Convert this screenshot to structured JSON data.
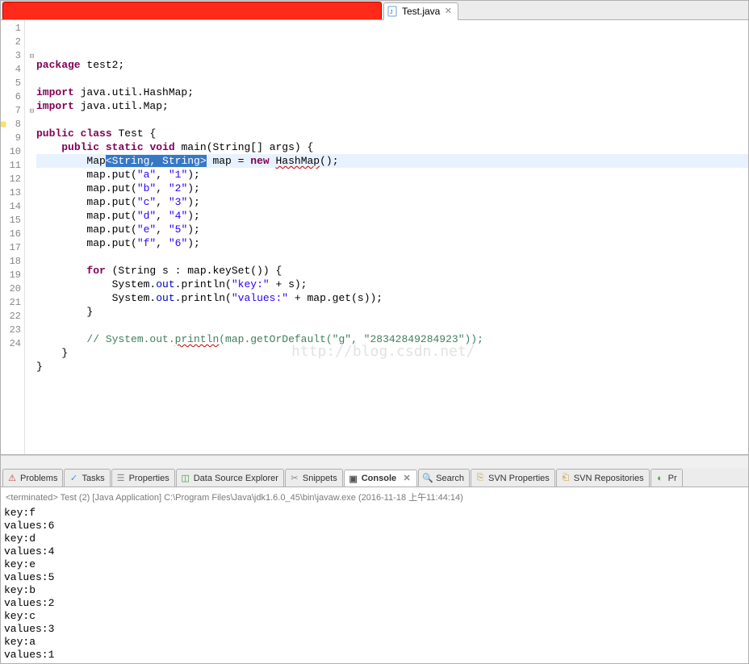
{
  "editor_tab": {
    "filename": "Test.java",
    "close_glyph": "✕"
  },
  "code": {
    "lines": [
      {
        "n": 1,
        "html": "<span class='kw'>package</span> test2;"
      },
      {
        "n": 2,
        "html": ""
      },
      {
        "n": 3,
        "fold": true,
        "html": "<span class='kw'>import</span> java.util.HashMap;"
      },
      {
        "n": 4,
        "html": "<span class='kw'>import</span> java.util.Map;"
      },
      {
        "n": 5,
        "html": ""
      },
      {
        "n": 6,
        "html": "<span class='kw'>public</span> <span class='kw'>class</span> Test {"
      },
      {
        "n": 7,
        "fold": true,
        "html": "    <span class='kw'>public</span> <span class='kw'>static</span> <span class='kw'>void</span> main(String[] args) {"
      },
      {
        "n": 8,
        "warn": true,
        "hl": true,
        "html": "        Map<span class='sel'>&lt;String, String&gt;</span> map = <span class='kw'>new</span> <span class='squig'>HashMap</span>();"
      },
      {
        "n": 9,
        "html": "        map.put(<span class='str'>\"a\"</span>, <span class='str'>\"1\"</span>);"
      },
      {
        "n": 10,
        "html": "        map.put(<span class='str'>\"b\"</span>, <span class='str'>\"2\"</span>);"
      },
      {
        "n": 11,
        "html": "        map.put(<span class='str'>\"c\"</span>, <span class='str'>\"3\"</span>);"
      },
      {
        "n": 12,
        "html": "        map.put(<span class='str'>\"d\"</span>, <span class='str'>\"4\"</span>);"
      },
      {
        "n": 13,
        "html": "        map.put(<span class='str'>\"e\"</span>, <span class='str'>\"5\"</span>);"
      },
      {
        "n": 14,
        "html": "        map.put(<span class='str'>\"f\"</span>, <span class='str'>\"6\"</span>);"
      },
      {
        "n": 15,
        "html": ""
      },
      {
        "n": 16,
        "html": "        <span class='kw'>for</span> (String s : map.keySet()) {"
      },
      {
        "n": 17,
        "html": "            System.<span class='fld'>out</span>.println(<span class='str'>\"key:\"</span> + s);"
      },
      {
        "n": 18,
        "html": "            System.<span class='fld'>out</span>.println(<span class='str'>\"values:\"</span> + map.get(s));"
      },
      {
        "n": 19,
        "html": "        }"
      },
      {
        "n": 20,
        "html": ""
      },
      {
        "n": 21,
        "html": "        <span class='cmt'>// System.out.<span class='squig'>println</span>(map.getOrDefault(\"g\", \"28342849284923\"));</span>"
      },
      {
        "n": 22,
        "html": "    }"
      },
      {
        "n": 23,
        "html": "}"
      },
      {
        "n": 24,
        "html": ""
      }
    ]
  },
  "watermark": "http://blog.csdn.net/",
  "views": [
    {
      "id": "problems",
      "label": "Problems",
      "icon": "⚠",
      "iconColor": "#c04040"
    },
    {
      "id": "tasks",
      "label": "Tasks",
      "icon": "✓",
      "iconColor": "#4a90d9"
    },
    {
      "id": "properties",
      "label": "Properties",
      "icon": "☰",
      "iconColor": "#888"
    },
    {
      "id": "datasource",
      "label": "Data Source Explorer",
      "icon": "◫",
      "iconColor": "#3a9a3a"
    },
    {
      "id": "snippets",
      "label": "Snippets",
      "icon": "✂",
      "iconColor": "#888"
    },
    {
      "id": "console",
      "label": "Console",
      "icon": "▣",
      "iconColor": "#555",
      "active": true,
      "closable": true
    },
    {
      "id": "search",
      "label": "Search",
      "icon": "🔍",
      "iconColor": "#c0a030"
    },
    {
      "id": "svnprops",
      "label": "SVN Properties",
      "icon": "⎘",
      "iconColor": "#c0a030"
    },
    {
      "id": "svnrepos",
      "label": "SVN Repositories",
      "icon": "⎗",
      "iconColor": "#c0a030"
    },
    {
      "id": "progress",
      "label": "Pr",
      "icon": "◐",
      "iconColor": "#3a9a3a"
    }
  ],
  "console": {
    "header": "<terminated> Test (2) [Java Application] C:\\Program Files\\Java\\jdk1.6.0_45\\bin\\javaw.exe (2016-11-18 上午11:44:14)",
    "lines": [
      "key:f",
      "values:6",
      "key:d",
      "values:4",
      "key:e",
      "values:5",
      "key:b",
      "values:2",
      "key:c",
      "values:3",
      "key:a",
      "values:1"
    ]
  }
}
